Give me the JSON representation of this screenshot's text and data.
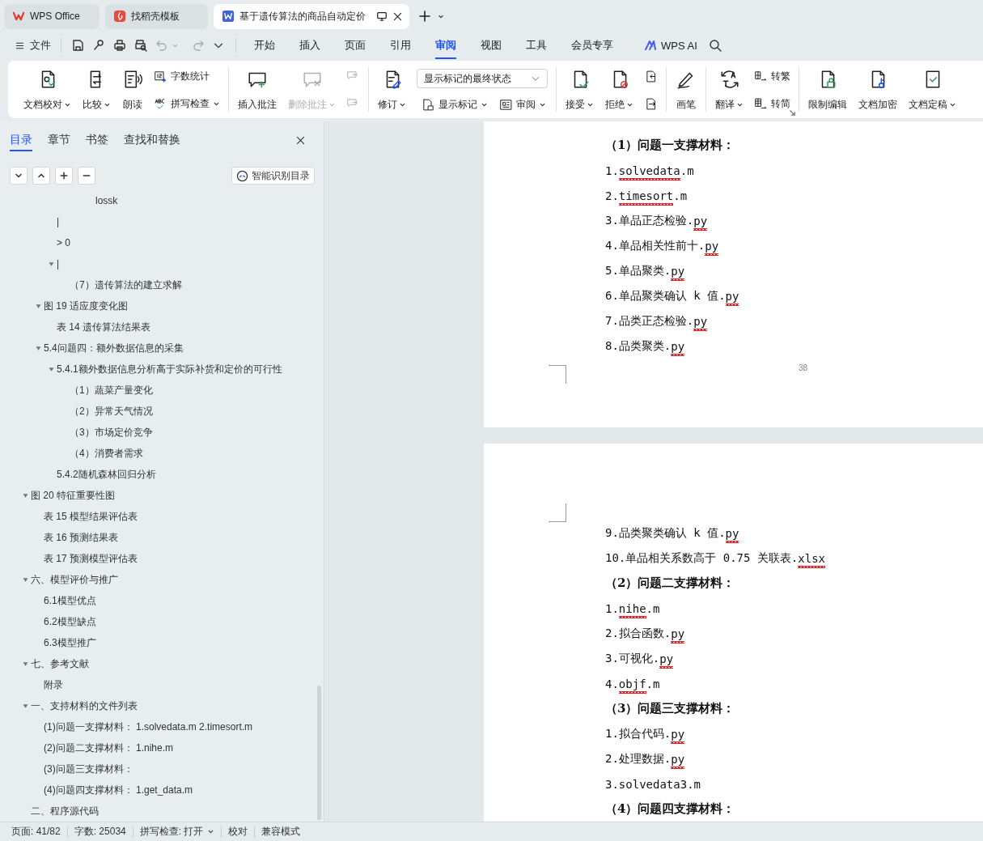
{
  "title_tabs": [
    {
      "label": "WPS Office",
      "kind": "home",
      "selected": false
    },
    {
      "label": "找稻壳模板",
      "kind": "template",
      "selected": false
    },
    {
      "label": "基于遗传算法的商品自动定价",
      "kind": "document",
      "selected": true
    }
  ],
  "toolbar": {
    "file_menu": "文件",
    "ai_label": "WPS AI",
    "tabs": [
      {
        "label": "开始",
        "selected": false
      },
      {
        "label": "插入",
        "selected": false
      },
      {
        "label": "页面",
        "selected": false
      },
      {
        "label": "引用",
        "selected": false
      },
      {
        "label": "审阅",
        "selected": true
      },
      {
        "label": "视图",
        "selected": false
      },
      {
        "label": "工具",
        "selected": false
      },
      {
        "label": "会员专享",
        "selected": false
      }
    ]
  },
  "ribbon": {
    "groups": [
      {
        "launcher": false,
        "items": [
          {
            "kind": "large",
            "label": "文档校对",
            "caret": true,
            "disabled": false
          },
          {
            "kind": "large",
            "label": "比较",
            "caret": true,
            "disabled": false
          },
          {
            "kind": "large",
            "label": "朗读",
            "caret": false,
            "disabled": false
          },
          {
            "kind": "stack",
            "rows": [
              {
                "label": "字数统计",
                "caret": false,
                "disabled": false
              },
              {
                "label": "拼写检查",
                "caret": true,
                "disabled": false
              }
            ]
          }
        ]
      },
      {
        "launcher": false,
        "items": [
          {
            "kind": "large",
            "label": "插入批注",
            "caret": false,
            "disabled": false
          },
          {
            "kind": "large",
            "label": "删除批注",
            "caret": true,
            "disabled": true
          },
          {
            "kind": "stack",
            "rows": [
              {
                "caret": false,
                "disabled": true
              },
              {
                "caret": false,
                "disabled": true
              }
            ]
          }
        ]
      },
      {
        "launcher": false,
        "items": [
          {
            "kind": "large",
            "label": "修订",
            "caret": true,
            "disabled": false
          },
          {
            "kind": "panel",
            "select": "显示标记的最终状态",
            "buttons": [
              {
                "label": "显示标记",
                "caret": true,
                "disabled": false
              },
              {
                "label": "审阅",
                "caret": true,
                "disabled": false
              }
            ]
          }
        ]
      },
      {
        "launcher": false,
        "items": [
          {
            "kind": "large",
            "label": "接受",
            "caret": true,
            "disabled": false
          },
          {
            "kind": "large",
            "label": "拒绝",
            "caret": true,
            "disabled": false
          },
          {
            "kind": "stack",
            "rows": [
              {
                "caret": false,
                "disabled": false
              },
              {
                "caret": false,
                "disabled": false
              }
            ]
          }
        ]
      },
      {
        "launcher": false,
        "items": [
          {
            "kind": "large",
            "label": "画笔",
            "caret": false,
            "disabled": false
          }
        ]
      },
      {
        "launcher": true,
        "items": [
          {
            "kind": "large",
            "label": "翻译",
            "caret": true,
            "disabled": false
          },
          {
            "kind": "stack",
            "rows": [
              {
                "label": "转繁",
                "caret": false,
                "disabled": false
              },
              {
                "label": "转简",
                "caret": false,
                "disabled": false
              }
            ]
          }
        ]
      },
      {
        "launcher": false,
        "items": [
          {
            "kind": "large",
            "label": "限制编辑",
            "caret": false,
            "disabled": false
          },
          {
            "kind": "large",
            "label": "文档加密",
            "caret": false,
            "disabled": false
          },
          {
            "kind": "large",
            "label": "文档定稿",
            "caret": true,
            "disabled": false
          }
        ]
      }
    ]
  },
  "sidebar": {
    "tabs": [
      {
        "label": "目录",
        "selected": true
      },
      {
        "label": "章节",
        "selected": false
      },
      {
        "label": "书签",
        "selected": false
      },
      {
        "label": "查找和替换",
        "selected": false
      }
    ],
    "smart_button": "智能识别目录",
    "outline": {
      "deepest_items": [
        {
          "label": "lossk"
        }
      ],
      "deeper_items": [
        {
          "label": "|"
        },
        {
          "label": "> 0"
        },
        {
          "label": "|",
          "expanded": true,
          "children": [
            {
              "label": "（7）遗传算法的建立求解"
            }
          ]
        }
      ],
      "inner_items": [
        {
          "label": "图 19 适应度变化图",
          "expanded": true,
          "children": [
            {
              "label": "表 14 遗传算法结果表"
            }
          ]
        },
        {
          "label": "5.4问题四：额外数据信息的采集",
          "expanded": true,
          "children": [
            {
              "label": "5.4.1额外数据信息分析高于实际补货和定价的可行性",
              "expanded": true,
              "children": [
                {
                  "label": "（1）蔬菜产量变化"
                },
                {
                  "label": "（2）异常天气情况"
                },
                {
                  "label": "（3）市场定价竞争"
                },
                {
                  "label": "（4）消费者需求"
                }
              ]
            },
            {
              "label": "5.4.2随机森林回归分析"
            }
          ]
        }
      ],
      "items": [
        {
          "label": "图 20 特征重要性图",
          "expanded": true,
          "children": [
            {
              "label": "表 15 模型结果评估表"
            },
            {
              "label": "表 16 预测结果表"
            },
            {
              "label": "表 17 预测模型评估表"
            }
          ]
        },
        {
          "label": "六、模型评价与推广",
          "expanded": true,
          "children": [
            {
              "label": "6.1模型优点"
            },
            {
              "label": "6.2模型缺点"
            },
            {
              "label": "6.3模型推广"
            }
          ]
        },
        {
          "label": "七、参考文献",
          "expanded": true,
          "children": [
            {
              "label": "附录"
            }
          ]
        },
        {
          "label": "一、支持材料的文件列表",
          "expanded": true,
          "children": [
            {
              "label": "(1)问题一支撑材料： 1.solvedata.m 2.timesort.m"
            },
            {
              "label": "(2)问题二支撑材料： 1.nihe.m"
            },
            {
              "label": "(3)问题三支撑材料："
            },
            {
              "label": "(4)问题四支撑材料： 1.get_data.m"
            }
          ]
        },
        {
          "label": "二、程序源代码"
        }
      ]
    }
  },
  "document": {
    "pages": [
      {
        "page_number": "38",
        "lines": [
          {
            "kind": "heading",
            "parts": [
              {
                "text": "（1）问题一支撑材料：",
                "misspelled": false
              }
            ]
          },
          {
            "kind": "item",
            "parts": [
              {
                "text": "1.",
                "misspelled": false
              },
              {
                "text": "solvedata",
                "misspelled": true
              },
              {
                "text": ".m",
                "misspelled": false
              }
            ]
          },
          {
            "kind": "item",
            "parts": [
              {
                "text": "2.",
                "misspelled": false
              },
              {
                "text": "timesort",
                "misspelled": true
              },
              {
                "text": ".m",
                "misspelled": false
              }
            ]
          },
          {
            "kind": "item",
            "parts": [
              {
                "text": "3.单品正态检验.",
                "misspelled": false
              },
              {
                "text": "py",
                "misspelled": true
              }
            ]
          },
          {
            "kind": "item",
            "parts": [
              {
                "text": "4.单品相关性前十.",
                "misspelled": false
              },
              {
                "text": "py",
                "misspelled": true
              }
            ]
          },
          {
            "kind": "item",
            "parts": [
              {
                "text": "5.单品聚类.",
                "misspelled": false
              },
              {
                "text": "py",
                "misspelled": true
              }
            ]
          },
          {
            "kind": "item",
            "parts": [
              {
                "text": "6.单品聚类确认 k 值.",
                "misspelled": false
              },
              {
                "text": "py",
                "misspelled": true
              }
            ]
          },
          {
            "kind": "item",
            "parts": [
              {
                "text": "7.品类正态检验.",
                "misspelled": false
              },
              {
                "text": "py",
                "misspelled": true
              }
            ]
          },
          {
            "kind": "item",
            "parts": [
              {
                "text": "8.品类聚类.",
                "misspelled": false
              },
              {
                "text": "py",
                "misspelled": true
              }
            ]
          }
        ]
      },
      {
        "lines": [
          {
            "kind": "item",
            "parts": [
              {
                "text": "9.品类聚类确认 k 值.",
                "misspelled": false
              },
              {
                "text": "py",
                "misspelled": true
              }
            ]
          },
          {
            "kind": "item",
            "parts": [
              {
                "text": "10.单品相关系数高于 0.75 关联表.",
                "misspelled": false
              },
              {
                "text": "xlsx",
                "misspelled": true
              }
            ]
          },
          {
            "kind": "heading",
            "parts": [
              {
                "text": "（2）问题二支撑材料：",
                "misspelled": false
              }
            ]
          },
          {
            "kind": "item",
            "parts": [
              {
                "text": "1.",
                "misspelled": false
              },
              {
                "text": "nihe",
                "misspelled": true
              },
              {
                "text": ".m",
                "misspelled": false
              }
            ]
          },
          {
            "kind": "item",
            "parts": [
              {
                "text": "2.拟合函数.",
                "misspelled": false
              },
              {
                "text": "py",
                "misspelled": true
              }
            ]
          },
          {
            "kind": "item",
            "parts": [
              {
                "text": "3.可视化.",
                "misspelled": false
              },
              {
                "text": "py",
                "misspelled": true
              }
            ]
          },
          {
            "kind": "item",
            "parts": [
              {
                "text": "4.",
                "misspelled": false
              },
              {
                "text": "objf",
                "misspelled": true
              },
              {
                "text": ".m",
                "misspelled": false
              }
            ]
          },
          {
            "kind": "heading",
            "parts": [
              {
                "text": "（3）问题三支撑材料：",
                "misspelled": false
              }
            ]
          },
          {
            "kind": "item",
            "parts": [
              {
                "text": "1.拟合代码.",
                "misspelled": false
              },
              {
                "text": "py",
                "misspelled": true
              }
            ]
          },
          {
            "kind": "item",
            "parts": [
              {
                "text": "2.处理数据.",
                "misspelled": false
              },
              {
                "text": "py",
                "misspelled": true
              }
            ]
          },
          {
            "kind": "item",
            "parts": [
              {
                "text": "3.solvedata3.m",
                "misspelled": false
              }
            ]
          },
          {
            "kind": "heading",
            "parts": [
              {
                "text": "（4）问题四支撑材料：",
                "misspelled": false
              }
            ]
          }
        ]
      }
    ]
  },
  "status_bar": [
    {
      "label": "页面: 41/82",
      "caret": false
    },
    {
      "label": "字数: 25034",
      "caret": false
    },
    {
      "label": "拼写检查: 打开",
      "caret": true
    },
    {
      "label": "校对",
      "caret": false
    },
    {
      "label": "兼容模式",
      "caret": false
    }
  ]
}
